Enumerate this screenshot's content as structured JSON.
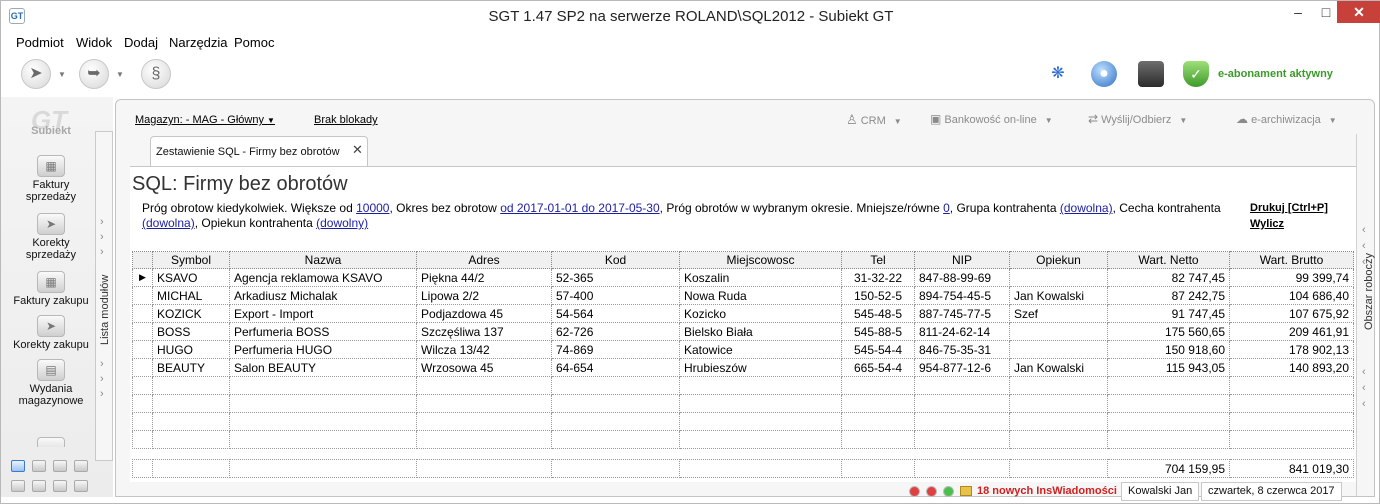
{
  "window": {
    "title": "SGT 1.47 SP2 na serwerze ROLAND\\SQL2012 - Subiekt GT",
    "app_icon": "GT",
    "min_glyph": "–",
    "max_glyph": "□",
    "close_glyph": "✕"
  },
  "menu": [
    "Podmiot",
    "Widok",
    "Dodaj",
    "Narzędzia",
    "Pomoc"
  ],
  "toolbar": {
    "subscription": "e-abonament aktywny"
  },
  "sidebar": {
    "logo": "GT",
    "logo_sub": "Subiekt",
    "modules": [
      {
        "label": "Faktury sprzedaży"
      },
      {
        "label": "Korekty sprzedaży"
      },
      {
        "label": "Faktury zakupu"
      },
      {
        "label": "Korekty zakupu"
      },
      {
        "label": "Wydania magazynowe"
      }
    ],
    "modules_bar_label": "Lista modułów"
  },
  "subbar": {
    "warehouse": "Magazyn: - MAG - Główny",
    "lock": "Brak blokady",
    "crm": "CRM",
    "banking": "Bankowość on-line",
    "send_receive": "Wyślij/Odbierz",
    "archive": "e-archiwizacja"
  },
  "tab": {
    "label": "Zestawienie SQL - Firmy bez obrotów",
    "close": "✕"
  },
  "report": {
    "title": "SQL: Firmy bez obrotów",
    "p1": "Próg obrotow kiedykolwiek. Większe od ",
    "v1": "10000",
    "p2": ", Okres bez obrotow ",
    "v2": "od 2017-01-01 do 2017-05-30",
    "p3": ", Próg obrotów w wybranym okresie. Mniejsze/równe ",
    "v3": "0",
    "p4": ", Grupa kontrahenta ",
    "v4": "(dowolna)",
    "p5": ", Cecha kontrahenta ",
    "v5": "(dowolna)",
    "p6": ", Opiekun kontrahenta ",
    "v6": "(dowolny)",
    "print": "Drukuj [Ctrl+P]",
    "calc": "Wylicz"
  },
  "workbar_label": "Obszar roboczy",
  "table": {
    "columns": [
      "Symbol",
      "Nazwa",
      "Adres",
      "Kod",
      "Miejscowosc",
      "Tel",
      "NIP",
      "Opiekun",
      "Wart. Netto",
      "Wart. Brutto"
    ],
    "current_row_marker": "▶",
    "rows": [
      [
        "KSAVO",
        "Agencja reklamowa KSAVO",
        "Piękna  44/2",
        "52-365",
        "Koszalin",
        "31-32-22",
        "847-88-99-69",
        "",
        "82 747,45",
        "99 399,74"
      ],
      [
        "MICHAL",
        "Arkadiusz Michalak",
        "Lipowa  2/2",
        "57-400",
        "Nowa Ruda",
        "150-52-5",
        "894-754-45-5",
        "Jan Kowalski",
        "87 242,75",
        "104 686,40"
      ],
      [
        "KOZICK",
        "Export - Import",
        "Podjazdowa 45",
        "54-564",
        "Kozicko",
        "545-48-5",
        "887-745-77-5",
        "Szef",
        "91 747,45",
        "107 675,92"
      ],
      [
        "BOSS",
        "Perfumeria BOSS",
        "Szczęśliwa  137",
        "62-726",
        "Bielsko Biała",
        "545-88-5",
        "811-24-62-14",
        "",
        "175 560,65",
        "209 461,91"
      ],
      [
        "HUGO",
        "Perfumeria HUGO",
        "Wilcza  13/42",
        "74-869",
        "Katowice",
        "545-54-4",
        "846-75-35-31",
        "",
        "150 918,60",
        "178 902,13"
      ],
      [
        "BEAUTY",
        "Salon BEAUTY",
        "Wrzosowa  45",
        "64-654",
        "Hrubieszów",
        "665-54-4",
        "954-877-12-6",
        "Jan Kowalski",
        "115 943,05",
        "140 893,20"
      ]
    ],
    "totals": {
      "netto": "704 159,95",
      "brutto": "841 019,30"
    }
  },
  "status": {
    "message": "18 nowych InsWiadomości",
    "user": "Kowalski Jan",
    "date": "czwartek, 8 czerwca 2017"
  },
  "colors": {
    "accent_link": "#1d1da8",
    "alert": "#d02020",
    "subscription_green": "#3a9a2a",
    "close_red": "#c7413a"
  }
}
